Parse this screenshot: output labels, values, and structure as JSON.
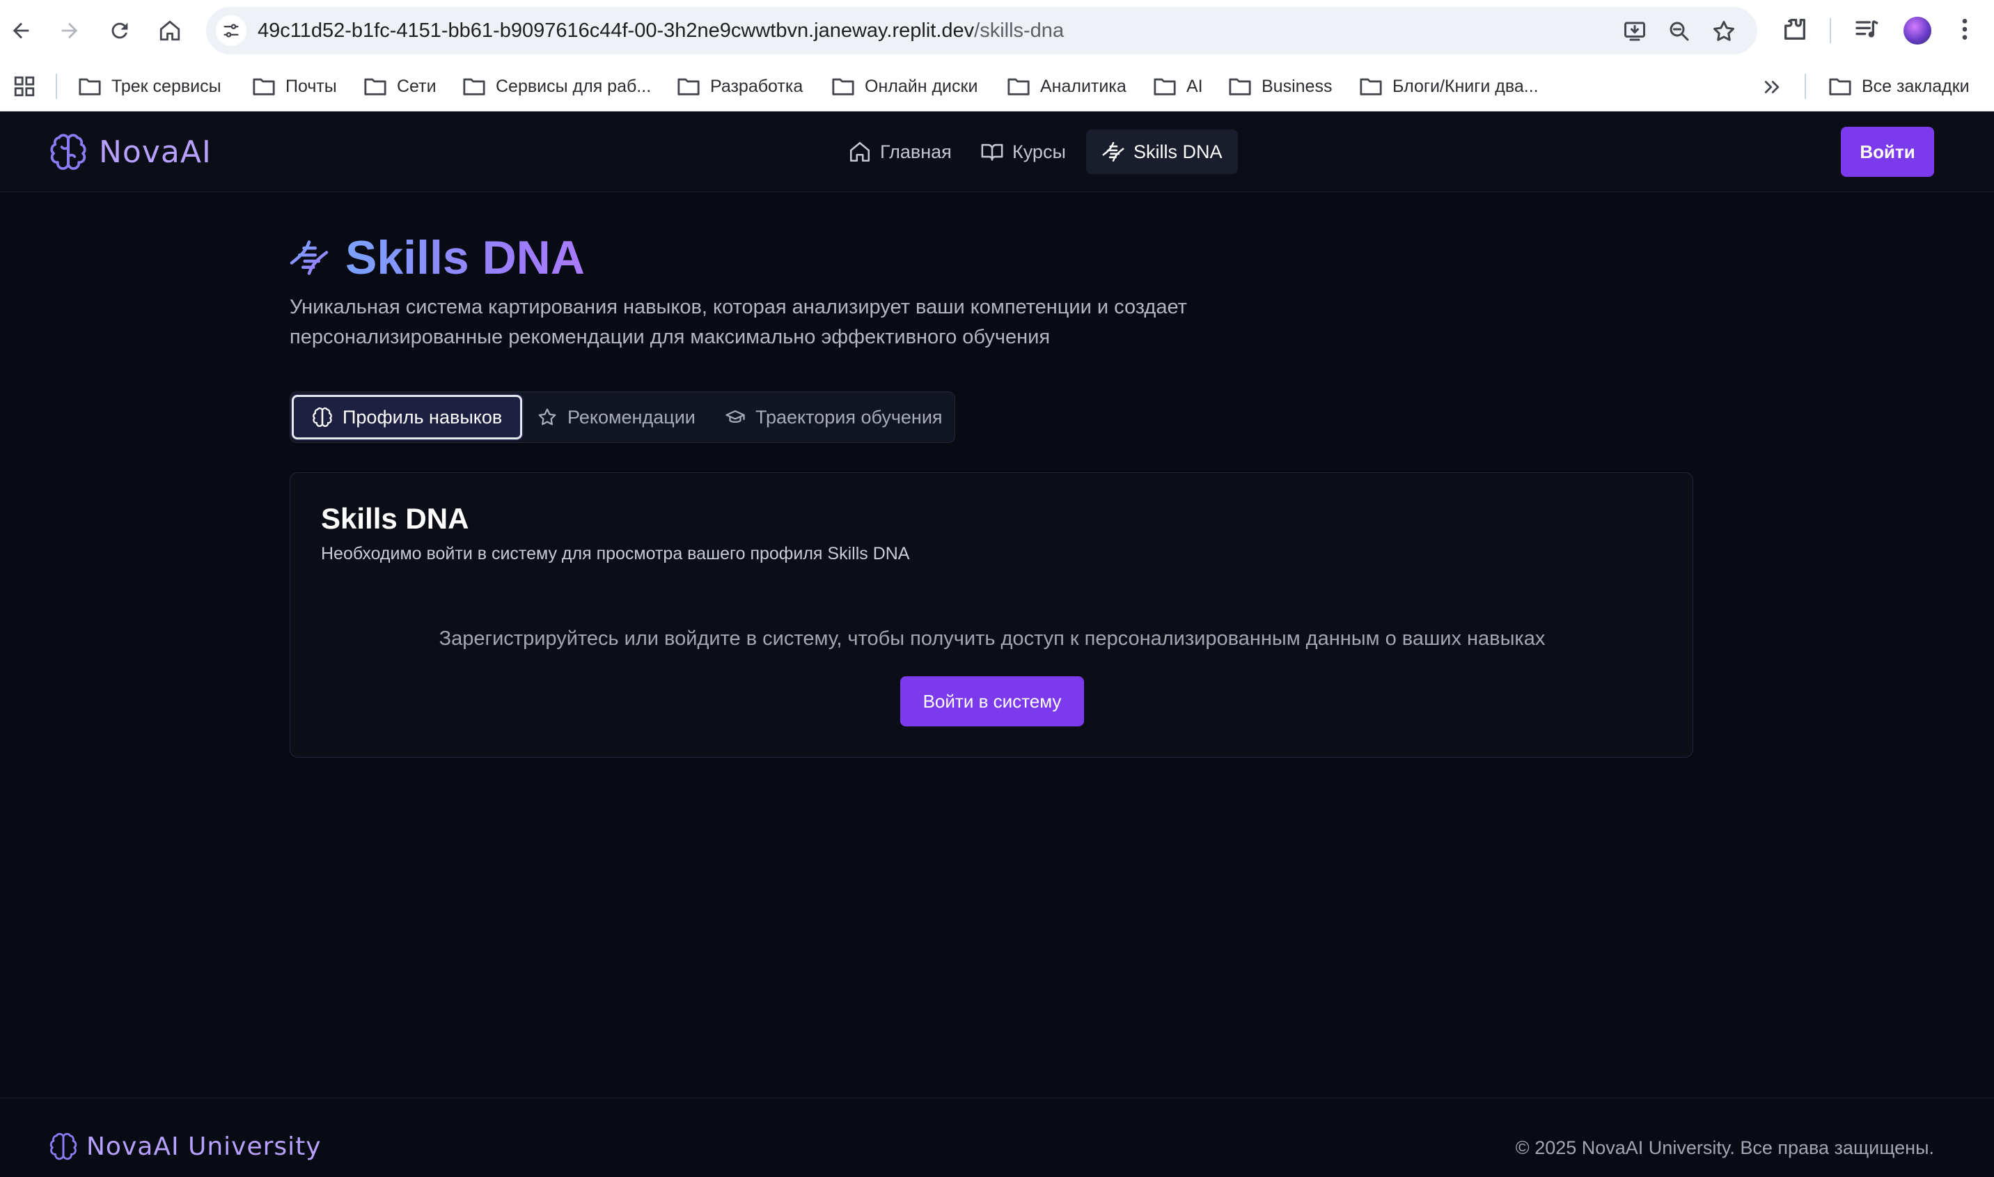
{
  "browser": {
    "url_host": "49c11d52-b1fc-4151-bb61-b9097616c44f-00-3h2ne9cwwtbvn.janeway.replit.dev",
    "url_path": "/skills-dna",
    "bookmarks": [
      "Трек сервисы",
      "Почты",
      "Сети",
      "Сервисы для раб...",
      "Разработка",
      "Онлайн диски",
      "Аналитика",
      "AI",
      "Business",
      "Блоги/Книги два..."
    ],
    "all_bookmarks": "Все закладки"
  },
  "header": {
    "logo": "NovaAI",
    "nav": [
      "Главная",
      "Курсы",
      "Skills DNA"
    ],
    "login": "Войти"
  },
  "main": {
    "title": "Skills DNA",
    "description_line1": "Уникальная система картирования навыков, которая анализирует ваши компетенции и создает",
    "description_line2": "персонализированные рекомендации для максимально эффективного обучения",
    "tabs": [
      "Профиль навыков",
      "Рекомендации",
      "Траектория обучения"
    ],
    "card": {
      "title": "Skills DNA",
      "subtitle": "Необходимо войти в систему для просмотра вашего профиля Skills DNA",
      "message": "Зарегистрируйтесь или войдите в систему, чтобы получить доступ к персонализированным данным о ваших навыках",
      "button": "Войти в систему"
    }
  },
  "footer": {
    "logo": "NovaAI University",
    "copyright": "© 2025 NovaAI University. Все права защищены."
  },
  "colors": {
    "accent": "#7c3aed",
    "background": "#090b14",
    "brand_text": "#b8a0ff"
  },
  "icons": [
    "back-icon",
    "forward-icon",
    "reload-icon",
    "home-icon",
    "tune-icon",
    "install-icon",
    "zoom-icon",
    "star-icon",
    "extensions-icon",
    "media-icon",
    "menu-icon",
    "apps-icon",
    "folder-icon",
    "brain-icon",
    "book-icon",
    "dna-icon",
    "graduation-cap-icon"
  ]
}
